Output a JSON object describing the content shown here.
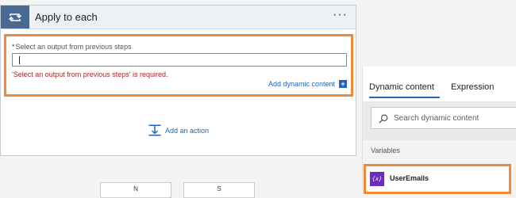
{
  "card": {
    "title": "Apply to each",
    "more_label": "···",
    "loop_icon": "loop-icon",
    "field": {
      "required_mark": "*",
      "label": "Select an output from previous steps",
      "value": "",
      "error": "'Select an output from previous steps' is required."
    },
    "add_dynamic_label": "Add dynamic content",
    "add_dynamic_icon": "+",
    "add_action_label": "Add an action"
  },
  "bottom_buttons": [
    {
      "label": "N"
    },
    {
      "label": "S"
    }
  ],
  "panel": {
    "tabs": [
      {
        "label": "Dynamic content",
        "active": true
      },
      {
        "label": "Expression",
        "active": false
      }
    ],
    "search_placeholder": "Search dynamic content",
    "section_title": "Variables",
    "variable": {
      "icon_text": "{x}",
      "label": "UserEmails"
    }
  },
  "colors": {
    "accent_blue": "#2465b3",
    "header_icon_bg": "#486991",
    "highlight_orange": "#ee8a3a",
    "error_red": "#a4262c",
    "variable_purple": "#6d2bc0"
  }
}
